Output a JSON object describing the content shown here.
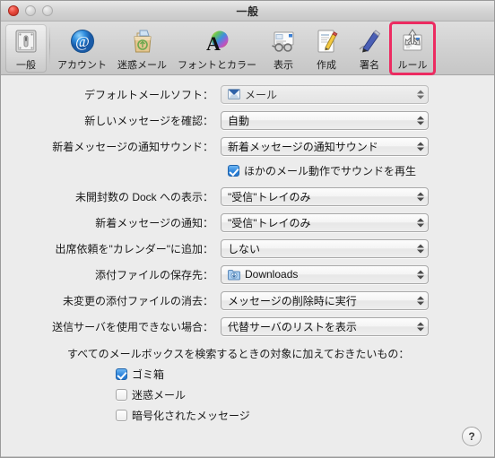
{
  "window": {
    "title": "一般",
    "traffic_lights": [
      {
        "name": "close",
        "color": "#e8493c",
        "enabled": true
      },
      {
        "name": "minimize",
        "color": "#d9d9d9",
        "enabled": false
      },
      {
        "name": "zoom",
        "color": "#d9d9d9",
        "enabled": false
      }
    ]
  },
  "toolbar": {
    "items": [
      {
        "label": "一般",
        "icon": "general-switch-icon",
        "selected": true,
        "highlighted": false
      },
      {
        "label": "アカウント",
        "icon": "at-sign-icon",
        "selected": false,
        "highlighted": false
      },
      {
        "label": "迷惑メール",
        "icon": "junk-mail-bag-icon",
        "selected": false,
        "highlighted": false
      },
      {
        "label": "フォントとカラー",
        "icon": "font-color-icon",
        "selected": false,
        "highlighted": false
      },
      {
        "label": "表示",
        "icon": "eyeglasses-icon",
        "selected": false,
        "highlighted": false
      },
      {
        "label": "作成",
        "icon": "compose-pencil-icon",
        "selected": false,
        "highlighted": false
      },
      {
        "label": "署名",
        "icon": "signature-pen-icon",
        "selected": false,
        "highlighted": false
      },
      {
        "label": "ルール",
        "icon": "rules-arrows-icon",
        "selected": false,
        "highlighted": true
      }
    ],
    "highlight_color": "#ec2b61"
  },
  "form": {
    "rows": [
      {
        "label": "デフォルトメールソフト：",
        "value": "メール",
        "icon": "mail-app-icon",
        "disabled": true
      },
      {
        "label": "新しいメッセージを確認：",
        "value": "自動",
        "icon": null,
        "disabled": false
      },
      {
        "label": "新着メッセージの通知サウンド：",
        "value": "新着メッセージの通知サウンド",
        "icon": null,
        "disabled": false
      }
    ],
    "sound_checkbox": {
      "label": "ほかのメール動作でサウンドを再生",
      "checked": true
    },
    "rows2": [
      {
        "label": "未開封数の Dock への表示：",
        "value": "\"受信\"トレイのみ",
        "icon": null,
        "disabled": false
      },
      {
        "label": "新着メッセージの通知：",
        "value": "\"受信\"トレイのみ",
        "icon": null,
        "disabled": false
      },
      {
        "label": "出席依頼を\"カレンダー\"に追加：",
        "value": "しない",
        "icon": null,
        "disabled": false
      },
      {
        "label": "添付ファイルの保存先：",
        "value": "Downloads",
        "icon": "downloads-folder-icon",
        "disabled": false
      },
      {
        "label": "未変更の添付ファイルの消去：",
        "value": "メッセージの削除時に実行",
        "icon": null,
        "disabled": false
      },
      {
        "label": "送信サーバを使用できない場合：",
        "value": "代替サーバのリストを表示",
        "icon": null,
        "disabled": false
      }
    ],
    "search_section": {
      "note": "すべてのメールボックスを検索するときの対象に加えておきたいもの：",
      "checkboxes": [
        {
          "label": "ゴミ箱",
          "checked": true
        },
        {
          "label": "迷惑メール",
          "checked": false
        },
        {
          "label": "暗号化されたメッセージ",
          "checked": false
        }
      ]
    },
    "help_button": "?"
  }
}
